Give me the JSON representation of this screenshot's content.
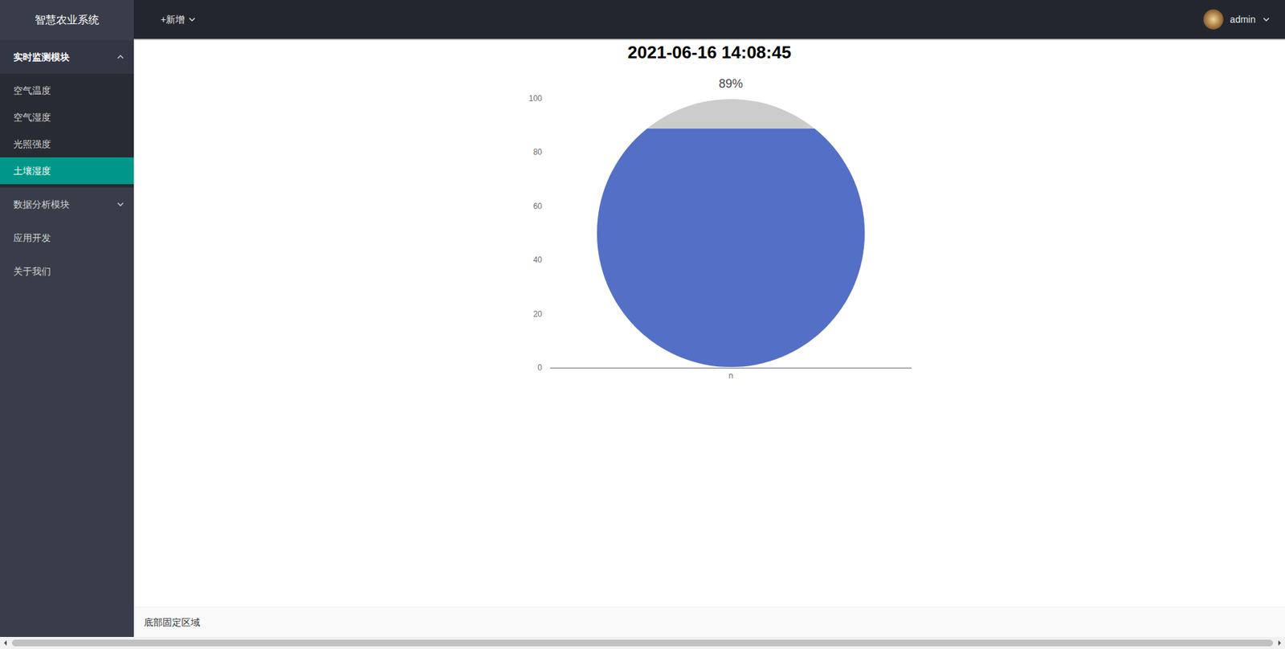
{
  "app": {
    "title": "智慧农业系统"
  },
  "header": {
    "add_menu": {
      "label": "+新增"
    },
    "user": {
      "name": "admin"
    }
  },
  "sidebar": {
    "groups": [
      {
        "label": "实时监测模块",
        "expanded": true,
        "items": [
          {
            "label": "空气温度",
            "selected": false
          },
          {
            "label": "空气湿度",
            "selected": false
          },
          {
            "label": "光照强度",
            "selected": false
          },
          {
            "label": "土壤湿度",
            "selected": true
          }
        ]
      },
      {
        "label": "数据分析模块",
        "expanded": false,
        "items": []
      }
    ],
    "links": [
      {
        "label": "应用开发",
        "selected": false
      },
      {
        "label": "关于我们",
        "selected": false
      }
    ]
  },
  "content": {
    "timestamp": "2021-06-16 14:08:45"
  },
  "chart": {
    "label": "89%",
    "values": [
      89
    ],
    "y_ticks": [
      "100",
      "80",
      "60",
      "40",
      "20",
      "0"
    ],
    "x_labels": [
      "n"
    ]
  },
  "footer": {
    "text": "底部固定区域"
  }
}
